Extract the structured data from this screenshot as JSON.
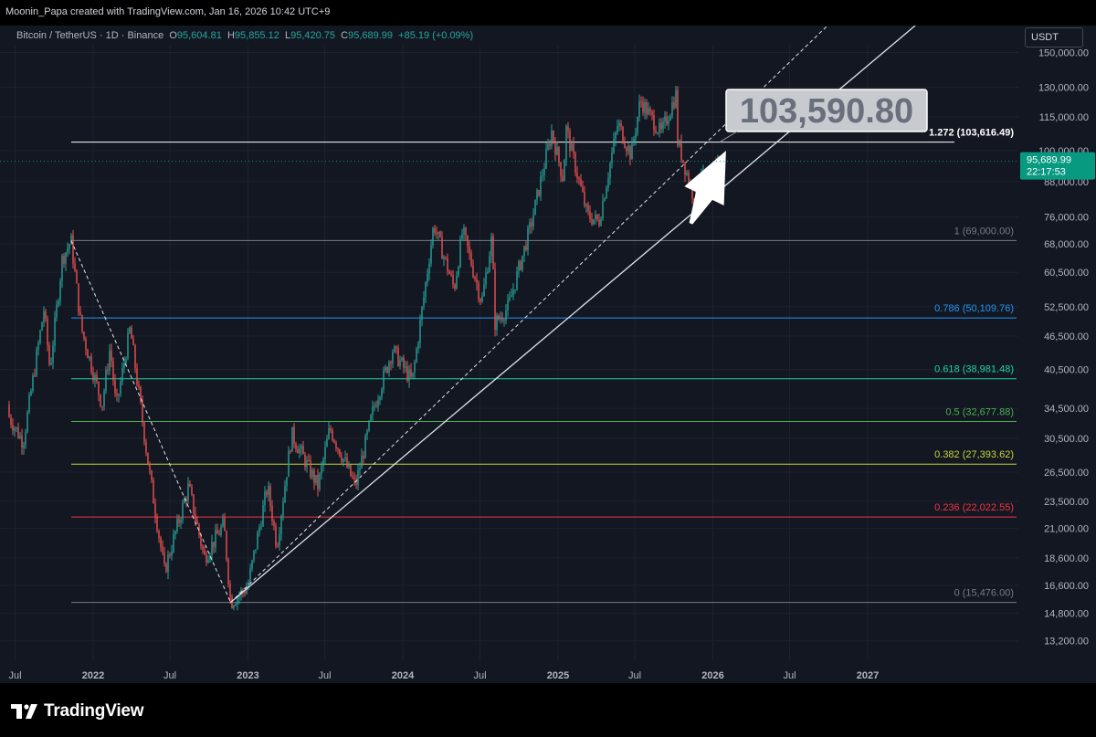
{
  "header": {
    "title": "Moonin_Papa created with TradingView.com, Jan 16, 2026 10:42 UTC+9"
  },
  "legend": {
    "symbol": "Bitcoin / TetherUS · 1D · Binance",
    "o_label": "O",
    "o_value": "95,604.81",
    "h_label": "H",
    "h_value": "95,855.12",
    "l_label": "L",
    "l_value": "95,420.75",
    "c_label": "C",
    "c_value": "95,689.99",
    "change": "+85.19 (+0.09%)"
  },
  "currency_button": "USDT",
  "footer": {
    "brand": "TradingView"
  },
  "colors": {
    "background": "#131722",
    "candle_up": "#26a69a",
    "candle_down": "#ef5350",
    "price_tag": "#089981",
    "fib_1": "#787b86",
    "fib_0786": "#2196f3",
    "fib_0618": "#1fd2a5",
    "fib_05": "#4caf50",
    "fib_0382": "#c6d639",
    "fib_0236": "#f23645",
    "fib_0": "#787b86",
    "fib_1272": "#ffffff"
  },
  "chart_data": {
    "type": "candlestick",
    "title": "Bitcoin / TetherUS · 1D · Binance",
    "y_scale": "log",
    "x_ticks": [
      "Jul",
      "2022",
      "Jul",
      "2023",
      "Jul",
      "2024",
      "Jul",
      "2025",
      "Jul",
      "2026",
      "Jul",
      "2027"
    ],
    "y_ticks": [
      "150,000.00",
      "130,000.00",
      "115,000.00",
      "100,000.00",
      "88,000.00",
      "76,000.00",
      "68,000.00",
      "60,500.00",
      "52,500.00",
      "46,500.00",
      "40,500.00",
      "34,500.00",
      "30,500.00",
      "26,500.00",
      "23,500.00",
      "21,000.00",
      "18,600.00",
      "16,600.00",
      "14,800.00",
      "13,200.00"
    ],
    "current_price": "95,689.99",
    "countdown": "22:17:53",
    "target_callout": "103,590.80",
    "fib_levels": [
      {
        "ratio": 1.272,
        "price": 103616.49,
        "label": "1.272 (103,616.49)"
      },
      {
        "ratio": 1,
        "price": 69000.0,
        "label": "1 (69,000.00)"
      },
      {
        "ratio": 0.786,
        "price": 50109.76,
        "label": "0.786 (50,109.76)"
      },
      {
        "ratio": 0.618,
        "price": 38981.48,
        "label": "0.618 (38,981.48)"
      },
      {
        "ratio": 0.5,
        "price": 32677.88,
        "label": "0.5 (32,677.88)"
      },
      {
        "ratio": 0.382,
        "price": 27393.62,
        "label": "0.382 (27,393.62)"
      },
      {
        "ratio": 0.236,
        "price": 22022.55,
        "label": "0.236 (22,022.55)"
      },
      {
        "ratio": 0,
        "price": 15476.0,
        "label": "0 (15,476.00)"
      }
    ],
    "price_path": [
      [
        "2021-06-01",
        35000
      ],
      [
        "2021-07-20",
        30000
      ],
      [
        "2021-09-07",
        52000
      ],
      [
        "2021-09-21",
        40500
      ],
      [
        "2021-10-20",
        64000
      ],
      [
        "2021-11-10",
        69000
      ],
      [
        "2021-12-04",
        48000
      ],
      [
        "2022-01-22",
        35000
      ],
      [
        "2022-02-10",
        44500
      ],
      [
        "2022-02-24",
        34500
      ],
      [
        "2022-03-29",
        48000
      ],
      [
        "2022-05-12",
        27000
      ],
      [
        "2022-06-18",
        17600
      ],
      [
        "2022-08-14",
        25000
      ],
      [
        "2022-09-20",
        18600
      ],
      [
        "2022-11-05",
        21400
      ],
      [
        "2022-11-21",
        15476
      ],
      [
        "2022-12-31",
        16500
      ],
      [
        "2023-02-16",
        25000
      ],
      [
        "2023-03-10",
        19600
      ],
      [
        "2023-04-14",
        31000
      ],
      [
        "2023-06-15",
        25000
      ],
      [
        "2023-07-13",
        31800
      ],
      [
        "2023-09-11",
        25000
      ],
      [
        "2023-10-24",
        34500
      ],
      [
        "2023-12-08",
        44000
      ],
      [
        "2024-01-23",
        38500
      ],
      [
        "2024-03-14",
        73800
      ],
      [
        "2024-05-01",
        56500
      ],
      [
        "2024-05-21",
        71900
      ],
      [
        "2024-07-05",
        53500
      ],
      [
        "2024-07-29",
        70000
      ],
      [
        "2024-08-05",
        49000
      ],
      [
        "2024-09-06",
        52500
      ],
      [
        "2024-10-29",
        73600
      ],
      [
        "2024-12-17",
        108300
      ],
      [
        "2025-01-13",
        89000
      ],
      [
        "2025-01-20",
        109600
      ],
      [
        "2025-03-11",
        76600
      ],
      [
        "2025-04-07",
        74500
      ],
      [
        "2025-05-22",
        111900
      ],
      [
        "2025-06-22",
        98200
      ],
      [
        "2025-07-14",
        123200
      ],
      [
        "2025-09-01",
        107300
      ],
      [
        "2025-10-06",
        126200
      ],
      [
        "2025-10-10",
        104000
      ],
      [
        "2025-11-21",
        80600
      ],
      [
        "2025-12-03",
        93000
      ],
      [
        "2025-12-18",
        84500
      ],
      [
        "2026-01-14",
        97900
      ],
      [
        "2026-01-16",
        95690
      ]
    ],
    "drawings": [
      {
        "type": "trendline_dashed",
        "from": [
          "2021-11-10",
          69000
        ],
        "to": [
          "2022-11-21",
          15476
        ]
      },
      {
        "type": "trendline_dashed",
        "from": [
          "2022-11-21",
          15476
        ],
        "to": [
          "2025-12-18",
          103616
        ]
      },
      {
        "type": "trendline_solid",
        "from": [
          "2022-11-21",
          15476
        ],
        "to": [
          "2026-06-01",
          103616
        ]
      },
      {
        "type": "arrow",
        "from": [
          "2025-11-10",
          74000
        ],
        "to": [
          "2026-02-01",
          100000
        ]
      }
    ]
  }
}
